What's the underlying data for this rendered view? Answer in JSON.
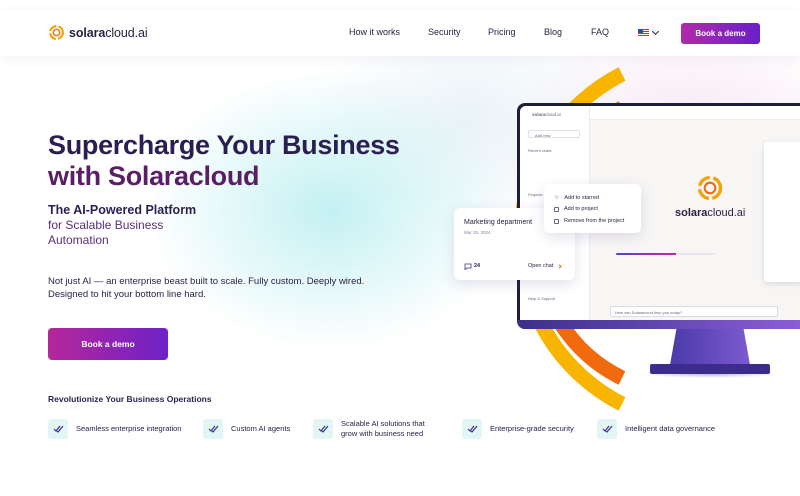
{
  "header": {
    "logo_prefix": "solara",
    "logo_suffix": "cloud.ai",
    "nav": [
      "How it works",
      "Security",
      "Pricing",
      "Blog",
      "FAQ"
    ],
    "language_icon": "us-flag-icon",
    "cta": "Book a demo"
  },
  "hero": {
    "title_line1": "Supercharge Your Business",
    "title_line2": "with Solaracloud",
    "subtitle_strong": "The AI-Powered Platform",
    "subtitle_rest": "for Scalable Business Automation",
    "paragraph": "Not just AI — an enterprise beast built to scale. Fully custom. Deeply wired. Designed to hit your bottom line hard.",
    "cta": "Book a demo"
  },
  "operations": {
    "title": "Revolutionize Your Business Operations",
    "features": [
      {
        "label": "Seamless enterprise integration",
        "icon": "double-check-icon"
      },
      {
        "label": "Custom AI agents",
        "icon": "double-check-icon"
      },
      {
        "label": "Scalable AI solutions that grow with business need",
        "icon": "double-check-icon"
      },
      {
        "label": "Enterprise-grade security",
        "icon": "double-check-icon"
      },
      {
        "label": "Intelligent data governance",
        "icon": "double-check-icon"
      }
    ]
  },
  "mockup": {
    "screen_logo_prefix": "solara",
    "screen_logo_suffix": "cloud.ai",
    "add_new": "Add new",
    "recent_chats": "Recent chats",
    "projects": "Projects",
    "help_support": "Help & Support",
    "input_placeholder": "How can Solaracloud help you today?",
    "dept_card": {
      "title": "Marketing department",
      "date": "Mar 25, 2024",
      "count": "24",
      "open_chat": "Open chat"
    },
    "context_menu": [
      "Add to starred",
      "Add to project",
      "Remove from the project"
    ]
  },
  "colors": {
    "brand_gradient_start": "#b02aa8",
    "brand_gradient_end": "#6a1fc9",
    "heading": "#2b1f52",
    "heading_accent": "#5a1e66",
    "arc_yellow": "#f7b500",
    "arc_orange": "#f26a0e",
    "feature_icon_bg": "#e3f6f6",
    "check": "#3b2f8a"
  }
}
